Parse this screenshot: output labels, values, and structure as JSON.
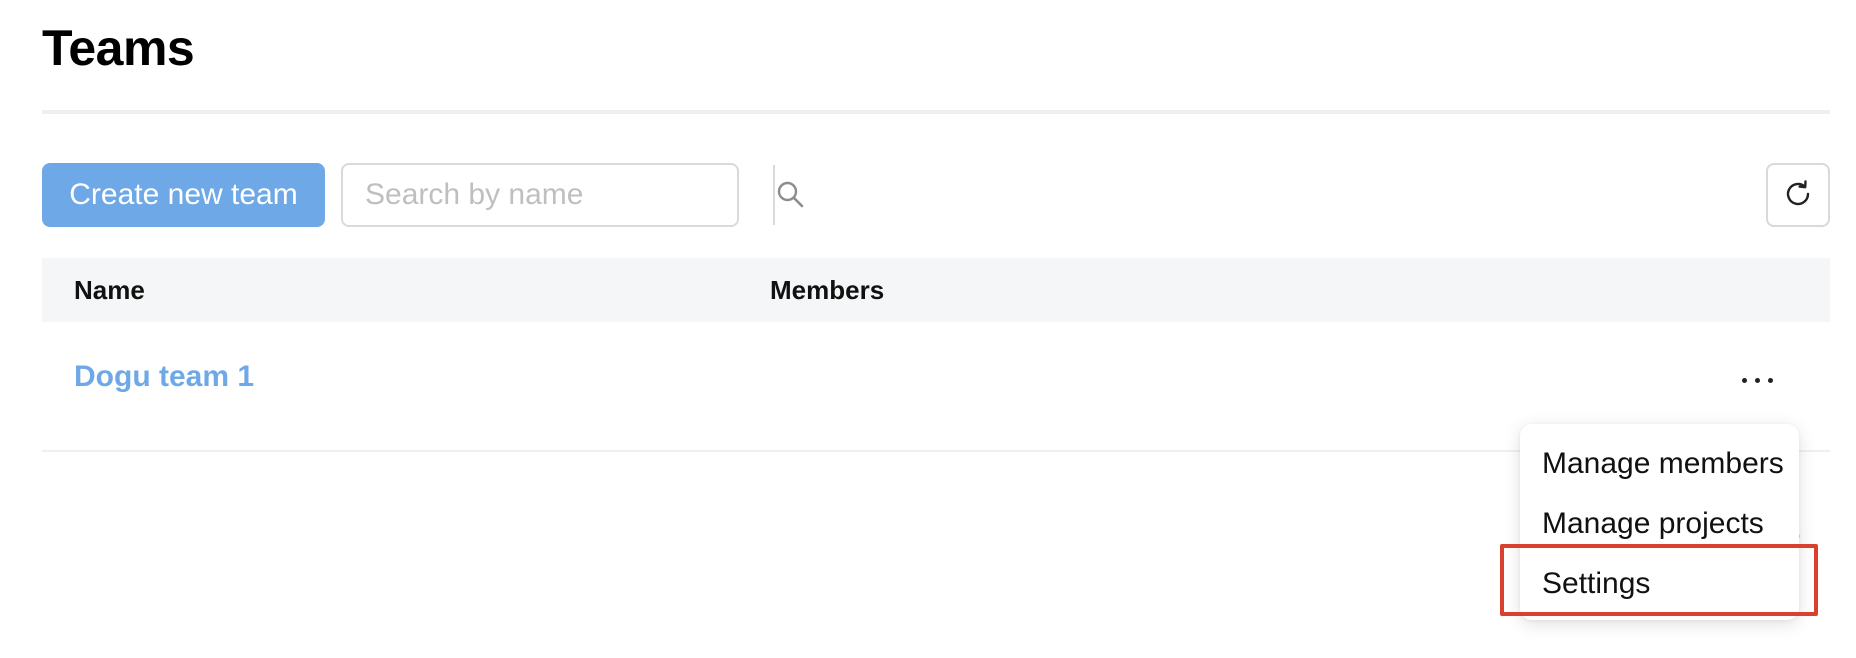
{
  "page": {
    "title": "Teams"
  },
  "toolbar": {
    "create_label": "Create new team",
    "search_placeholder": "Search by name",
    "search_icon": "search-icon",
    "refresh_icon": "refresh-icon"
  },
  "table": {
    "columns": [
      "Name",
      "Members"
    ],
    "rows": [
      {
        "name": "Dogu team 1",
        "members": ""
      }
    ]
  },
  "menu": {
    "items": [
      "Manage members",
      "Manage projects",
      "Settings"
    ],
    "highlighted": "Settings"
  },
  "colors": {
    "accent": "#6fa8e6",
    "highlight": "#d9412e",
    "header_bg": "#f5f6f7"
  }
}
